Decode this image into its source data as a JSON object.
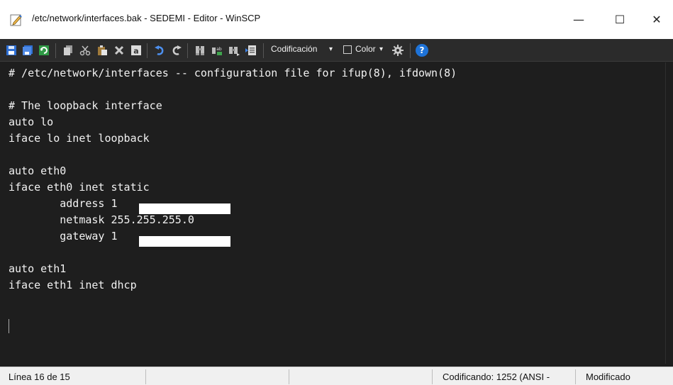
{
  "window": {
    "title": "/etc/network/interfaces.bak - SEDEMI - Editor - WinSCP",
    "minimize_glyph": "—",
    "maximize_glyph": "☐",
    "close_glyph": "✕"
  },
  "toolbar": {
    "encoding_label": "Codificación",
    "color_label": "Color",
    "dropdown_glyph": "▾",
    "help_glyph": "?",
    "icons": [
      "save-icon",
      "save-close-icon",
      "reload-icon",
      "copy-icon",
      "cut-icon",
      "paste-icon",
      "delete-icon",
      "select-all-icon",
      "undo-icon",
      "redo-icon",
      "find-icon",
      "replace-icon",
      "find-next-icon",
      "goto-line-icon",
      "settings-gear-icon",
      "help-icon"
    ]
  },
  "editor": {
    "lines": [
      "# /etc/network/interfaces -- configuration file for ifup(8), ifdown(8)",
      "",
      "# The loopback interface",
      "auto lo",
      "iface lo inet loopback",
      "",
      "auto eth0",
      "iface eth0 inet static",
      "        address 1",
      "        netmask 255.255.255.0",
      "        gateway 1",
      "",
      "auto eth1",
      "iface eth1 inet dhcp",
      ""
    ]
  },
  "status": {
    "position": "Línea 16 de 15",
    "cell2": "",
    "cell3": "",
    "encoding": "Codificando: 1252  (ANSI -",
    "modified": "Modificado"
  },
  "colors": {
    "editor_bg": "#1e1e1e",
    "editor_text": "#f2f2f2",
    "toolbar_bg": "#2b2b2b",
    "help_blue": "#1e73d8"
  }
}
